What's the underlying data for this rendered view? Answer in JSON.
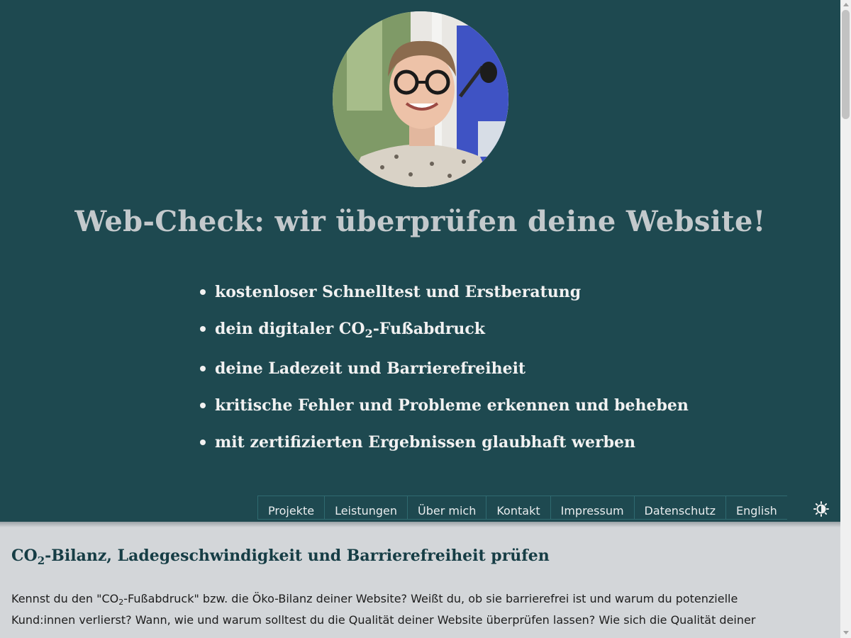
{
  "hero": {
    "title": "Web-Check: wir überprüfen deine Website!",
    "features": [
      {
        "text": "kostenloser Schnelltest und Erstberatung"
      },
      {
        "before": "dein digitaler CO",
        "sub": "2",
        "after": "-Fußabdruck"
      },
      {
        "text": "deine Ladezeit und Barrierefreiheit"
      },
      {
        "text": "kritische Fehler und Probleme erkennen und beheben"
      },
      {
        "text": "mit zertifizierten Ergebnissen glaubhaft werben"
      }
    ]
  },
  "nav": {
    "items": [
      "Projekte",
      "Leistungen",
      "Über mich",
      "Kontakt",
      "Impressum",
      "Datenschutz",
      "English"
    ],
    "theme_toggle_icon": "contrast-icon"
  },
  "content": {
    "title_before": "CO",
    "title_sub": "2",
    "title_after": "-Bilanz, Ladegeschwindigkeit und Barrierefreiheit prüfen",
    "p_part1": "Kennst du den \"CO",
    "p_sub": "2",
    "p_part2": "-Fußabdruck\" bzw. die Öko-Bilanz deiner Website? Weißt du, ob sie barrierefrei ist und warum du potenzielle Kund:innen verlierst? Wann, wie und warum solltest du die Qualität deiner Website überprüfen lassen? Wie sich die Qualität deiner"
  },
  "colors": {
    "hero_bg": "#1e4950",
    "page_bg": "#d3d6d9",
    "title_color": "#c3c9cc",
    "heading_color": "#163d45"
  }
}
